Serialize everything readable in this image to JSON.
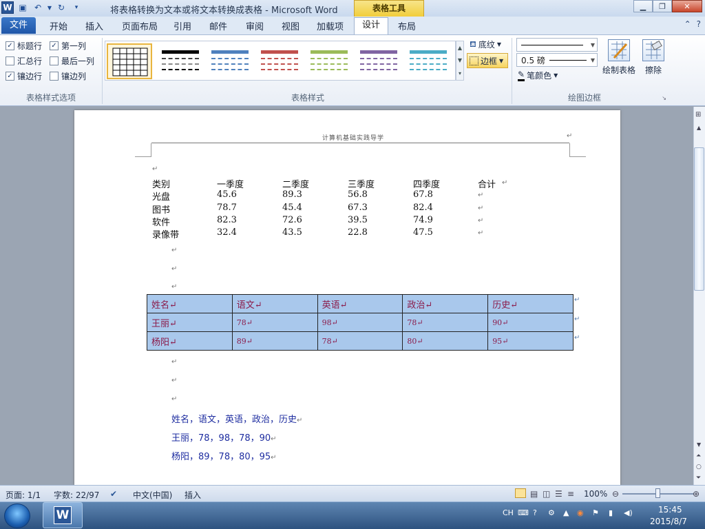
{
  "window": {
    "title": "将表格转换为文本或将文本转换成表格 - Microsoft Word",
    "context_tab_group": "表格工具",
    "app_letter": "W"
  },
  "tabs": {
    "file": "文件",
    "items": [
      "开始",
      "插入",
      "页面布局",
      "引用",
      "邮件",
      "审阅",
      "视图",
      "加载项"
    ],
    "design": "设计",
    "layout": "布局"
  },
  "ribbon": {
    "style_options": {
      "label": "表格样式选项",
      "items": [
        {
          "label": "标题行",
          "checked": true
        },
        {
          "label": "第一列",
          "checked": true
        },
        {
          "label": "汇总行",
          "checked": false
        },
        {
          "label": "最后一列",
          "checked": false
        },
        {
          "label": "镶边行",
          "checked": true
        },
        {
          "label": "镶边列",
          "checked": false
        }
      ]
    },
    "table_styles": {
      "label": "表格样式",
      "shading": "底纹",
      "borders": "边框",
      "colors": [
        "#000000",
        "#000000",
        "#4f81bd",
        "#c0504d",
        "#9bbb59",
        "#8064a2",
        "#4bacc6"
      ]
    },
    "draw_borders": {
      "label": "绘图边框",
      "line_weight": "0.5 磅",
      "pen_color": "笔颜色",
      "draw_table": "绘制表格",
      "eraser": "擦除"
    }
  },
  "document": {
    "header": "计算机基础实践导学",
    "tab_table": {
      "headers": [
        "类别",
        "一季度",
        "二季度",
        "三季度",
        "四季度",
        "合计"
      ],
      "rows": [
        [
          "光盘",
          "45.6",
          "89.3",
          "56.8",
          "67.8"
        ],
        [
          "图书",
          "78.7",
          "45.4",
          "67.3",
          "82.4"
        ],
        [
          "软件",
          "82.3",
          "72.6",
          "39.5",
          "74.9"
        ],
        [
          "录像带",
          "32.4",
          "43.5",
          "22.8",
          "47.5"
        ]
      ]
    },
    "grades_table": {
      "headers": [
        "姓名",
        "语文",
        "英语",
        "政治",
        "历史"
      ],
      "rows": [
        [
          "王丽",
          "78",
          "98",
          "78",
          "90"
        ],
        [
          "杨阳",
          "89",
          "78",
          "80",
          "95"
        ]
      ]
    },
    "comma_text": [
      "姓名，语文，英语，政治，历史",
      "王丽，78，98，78，90",
      "杨阳，89，78，80，95"
    ],
    "paragraph_mark": "↵"
  },
  "status": {
    "page": "页面: 1/1",
    "words": "字数: 22/97",
    "language": "中文(中国)",
    "mode": "插入",
    "zoom": "100%",
    "zoom_percent": 100
  },
  "taskbar": {
    "ime": "CH",
    "time": "15:45",
    "date": "2015/8/7"
  }
}
